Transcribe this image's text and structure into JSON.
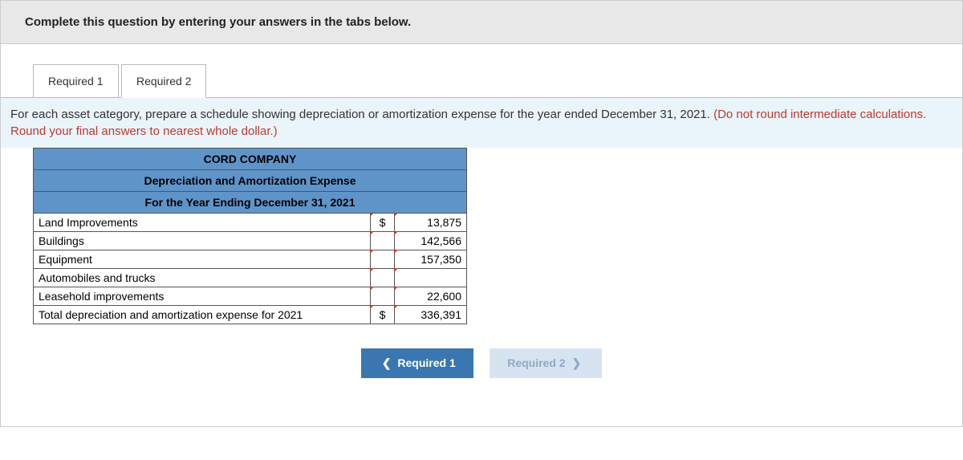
{
  "instruction": "Complete this question by entering your answers in the tabs below.",
  "tabs": {
    "tab1": "Required 1",
    "tab2": "Required 2"
  },
  "question": {
    "main": "For each asset category, prepare a schedule showing depreciation or amortization expense for the year ended December 31, 2021. ",
    "hint": "(Do not round intermediate calculations. Round your final answers to nearest whole dollar.)"
  },
  "schedule": {
    "company": "CORD COMPANY",
    "title": "Depreciation and Amortization Expense",
    "period": "For the Year Ending December 31, 2021",
    "rows": [
      {
        "label": "Land Improvements",
        "currency": "$",
        "value": "13,875"
      },
      {
        "label": "Buildings",
        "currency": "",
        "value": "142,566"
      },
      {
        "label": "Equipment",
        "currency": "",
        "value": "157,350"
      },
      {
        "label": "Automobiles and trucks",
        "currency": "",
        "value": ""
      },
      {
        "label": "Leasehold improvements",
        "currency": "",
        "value": "22,600"
      },
      {
        "label": "Total depreciation and amortization expense for 2021",
        "currency": "$",
        "value": "336,391"
      }
    ]
  },
  "nav": {
    "prev": "Required 1",
    "next": "Required 2"
  }
}
